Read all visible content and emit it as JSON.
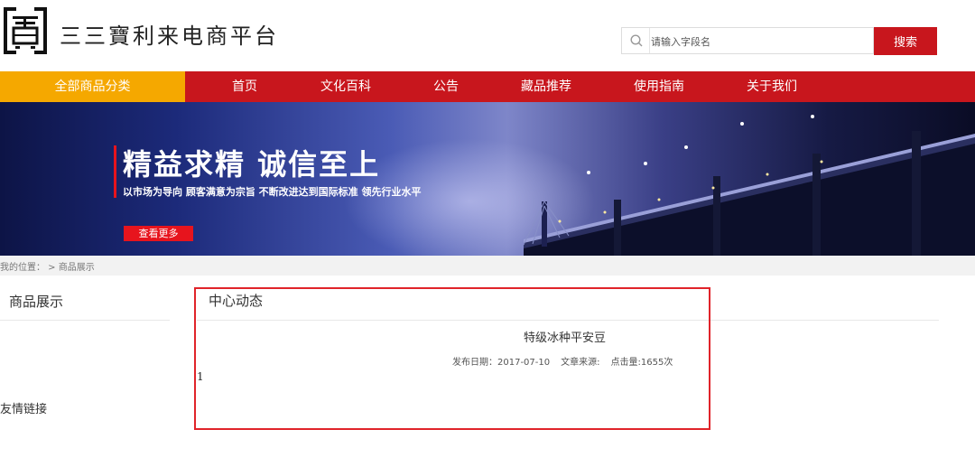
{
  "header": {
    "site_title": "三三寶利来电商平台",
    "search_placeholder": "请输入字段名",
    "search_button": "搜索"
  },
  "nav": {
    "all_categories": "全部商品分类",
    "items": [
      "首页",
      "文化百科",
      "公告",
      "藏品推荐",
      "使用指南",
      "关于我们"
    ]
  },
  "banner": {
    "title": "精益求精 诚信至上",
    "subtitle": "以市场为导向 顾客满意为宗旨 不断改进达到国际标准 领先行业水平",
    "button": "查看更多"
  },
  "breadcrumb": "我的位置： > 商品展示",
  "sidebar": {
    "title": "商品展示",
    "friend_links": "友情链接"
  },
  "main": {
    "section_title": "中心动态",
    "article": {
      "title": "特级冰种平安豆",
      "publish_date": "发布日期：2017-07-10",
      "source": "文章来源:",
      "views": "点击量:1655次",
      "body": "1"
    }
  },
  "colors": {
    "brand_red": "#c8161d",
    "nav_yellow": "#f5a800",
    "highlight_red": "#e0242a"
  }
}
